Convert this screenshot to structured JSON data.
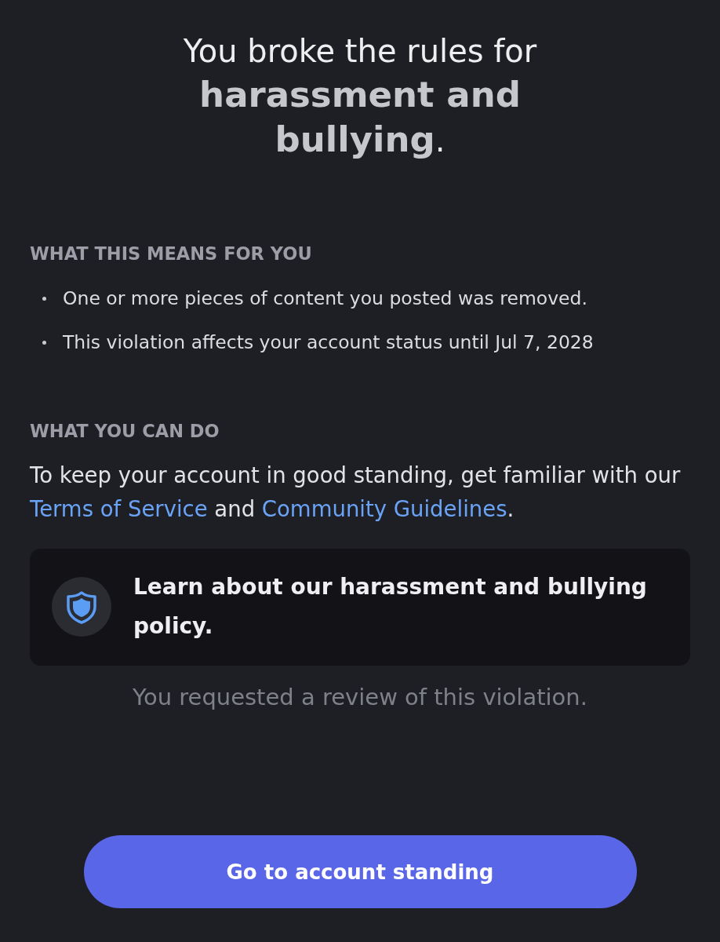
{
  "title": "You broke the rules for **harassment and bullying**.",
  "sections": [
    {
      "kind": "bullets",
      "heading": "WHAT THIS MEANS FOR YOU",
      "items": [
        "One or more pieces of content you posted was removed.",
        "This violation affects your account status until Jul 7, 2028"
      ]
    },
    {
      "kind": "paragraph",
      "heading": "WHAT YOU CAN DO",
      "parts": [
        {
          "kind": "text",
          "text": "To keep your account in good standing, get familiar with our "
        },
        {
          "kind": "link",
          "text": "Terms of Service"
        },
        {
          "kind": "text",
          "text": " and "
        },
        {
          "kind": "link",
          "text": "Community Guidelines"
        },
        {
          "kind": "text",
          "text": "."
        }
      ]
    }
  ],
  "policy_card": {
    "text": "Learn about our harassment and bullying policy."
  },
  "review_note": "You requested a review of this violation.",
  "primary_button": {
    "label": "Go to account standing"
  }
}
